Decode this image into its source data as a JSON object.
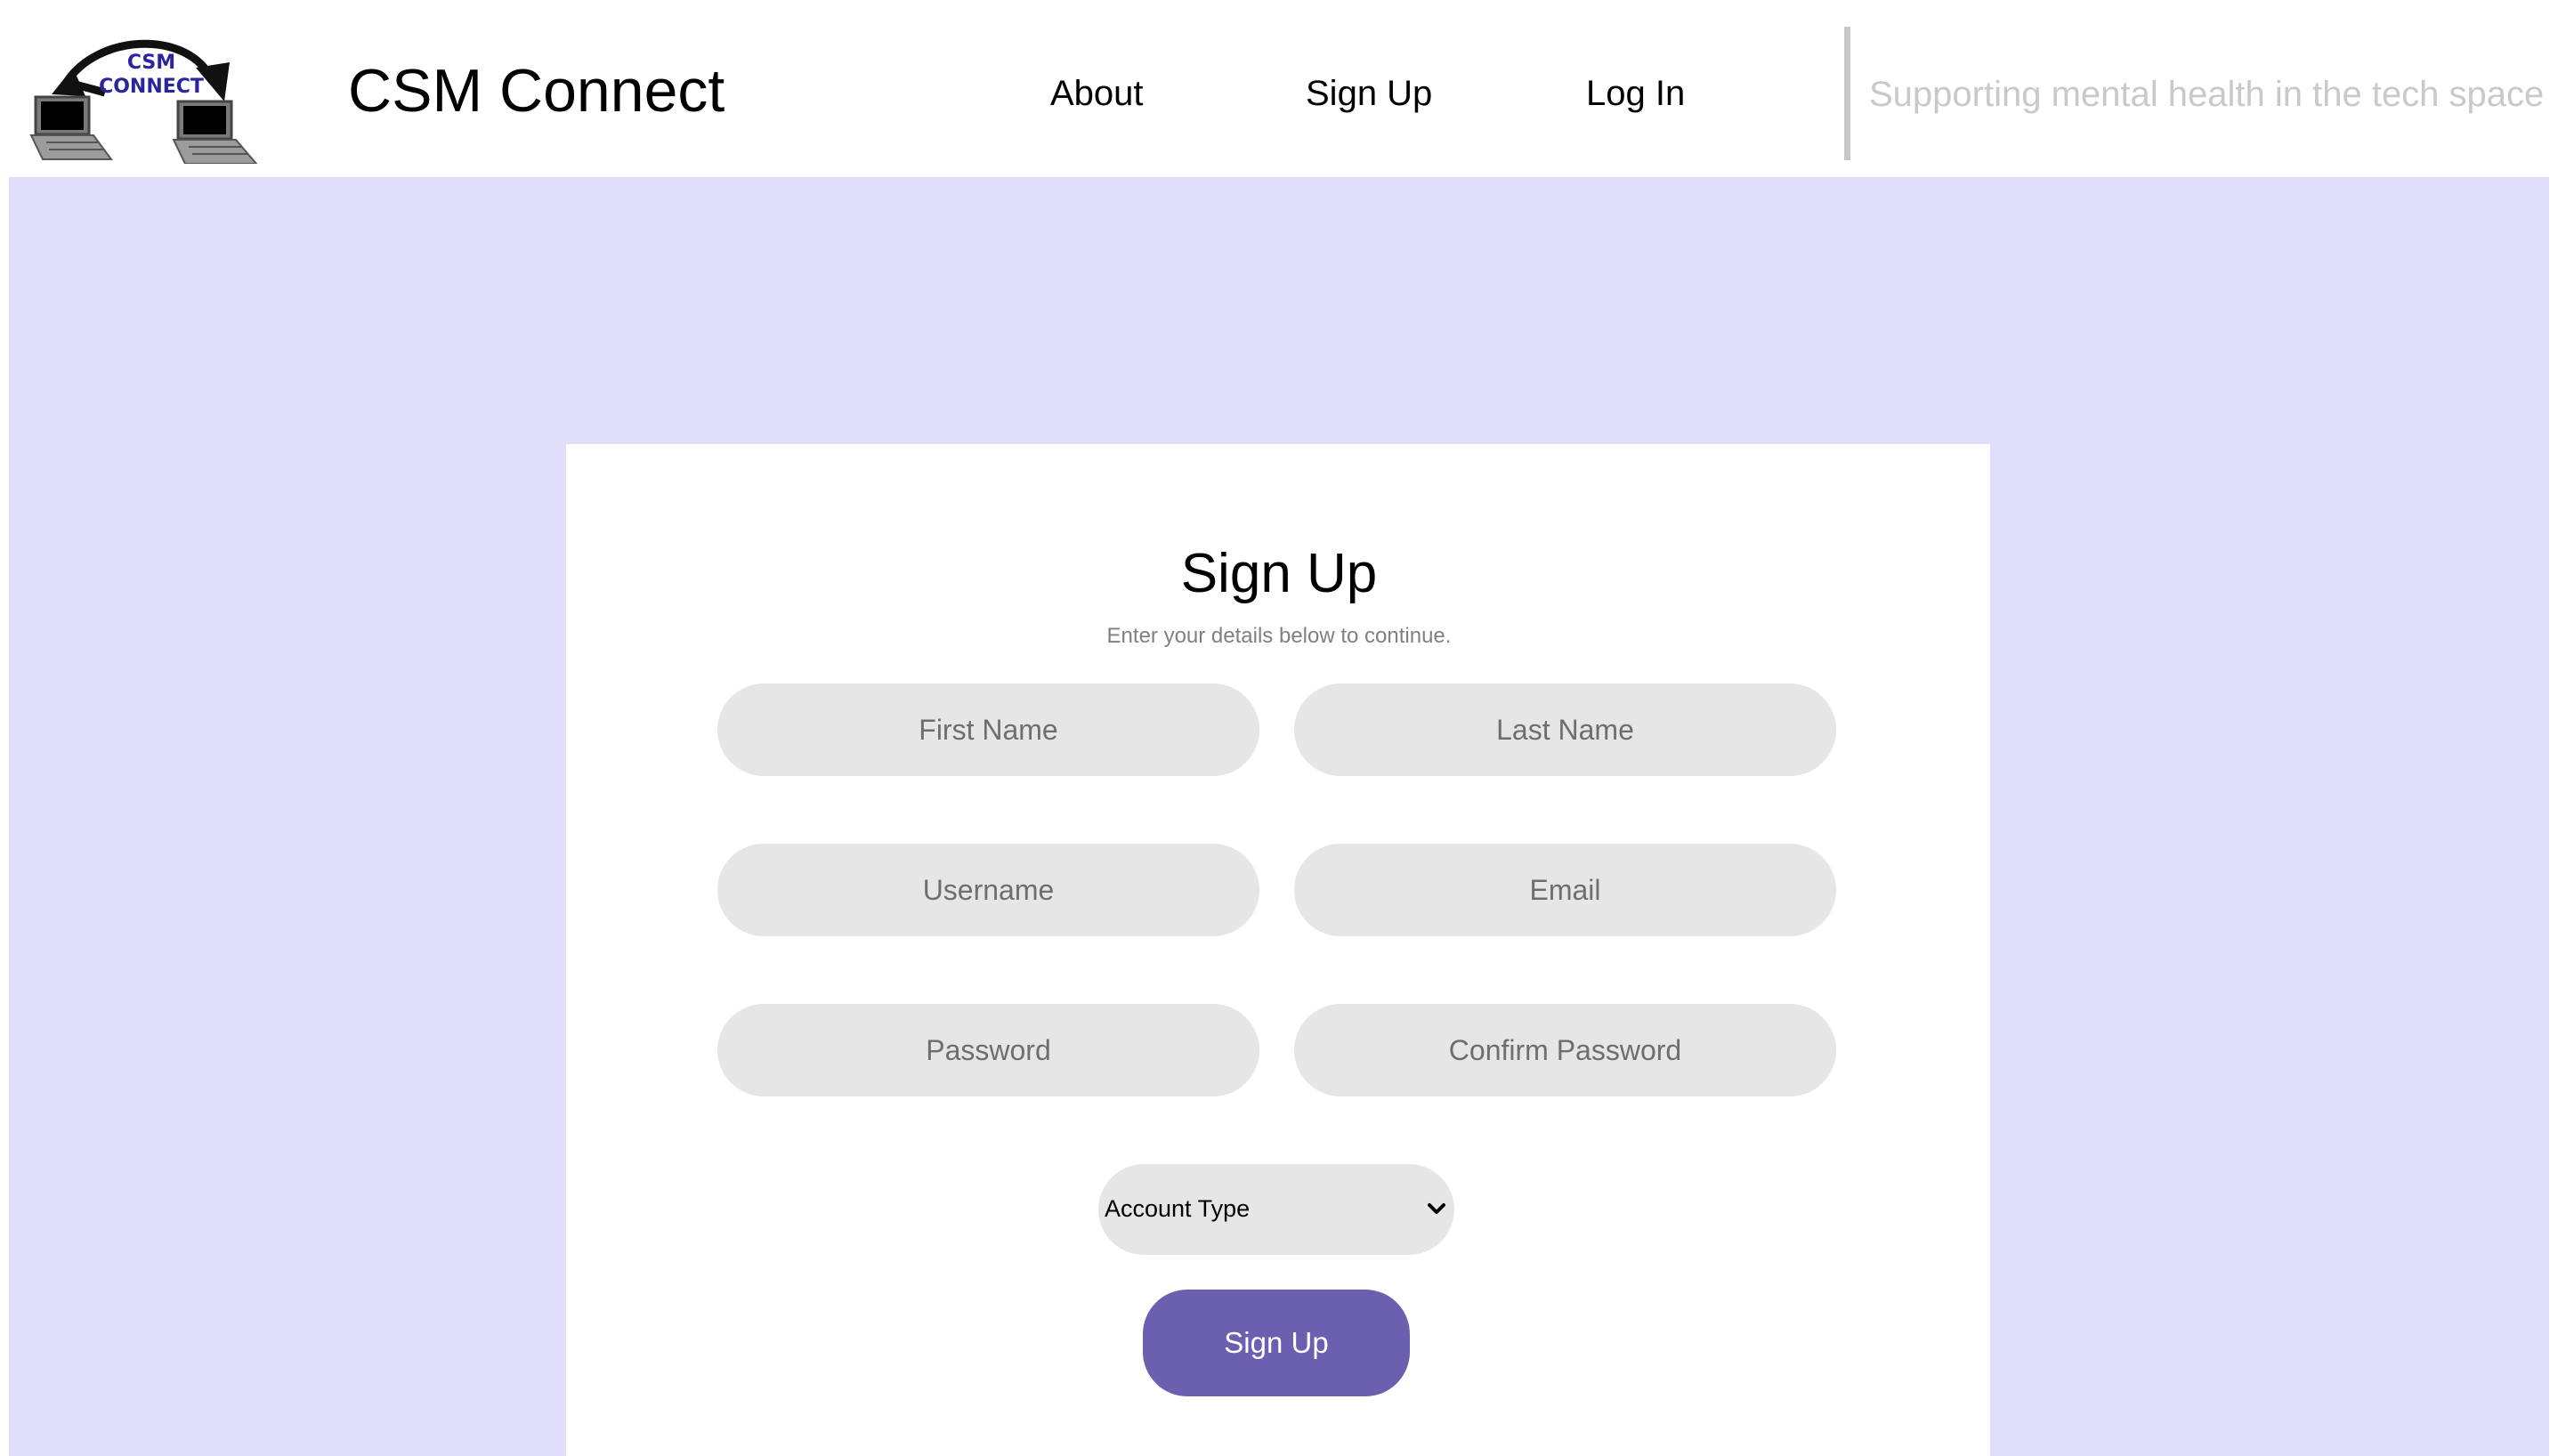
{
  "header": {
    "logo": {
      "icon": "csm-connect-logo-icon",
      "text_line_1": "CSM",
      "text_line_2": "CONNECT"
    },
    "brand": "CSM Connect",
    "nav": {
      "about": "About",
      "sign_up": "Sign Up",
      "log_in": "Log In"
    },
    "tagline": "Supporting mental health in the tech space"
  },
  "form": {
    "title": "Sign Up",
    "subtitle": "Enter your details below to continue.",
    "fields": {
      "first_name": {
        "placeholder": "First Name",
        "value": ""
      },
      "last_name": {
        "placeholder": "Last Name",
        "value": ""
      },
      "username": {
        "placeholder": "Username",
        "value": ""
      },
      "email": {
        "placeholder": "Email",
        "value": ""
      },
      "password": {
        "placeholder": "Password",
        "value": ""
      },
      "confirm_password": {
        "placeholder": "Confirm Password",
        "value": ""
      }
    },
    "account_type": {
      "selected": "Account Type",
      "icon": "chevron-down-icon"
    },
    "submit_label": "Sign Up"
  },
  "colors": {
    "page_background": "#e0defb",
    "card_background": "#ffffff",
    "field_background": "#e6e6e6",
    "button_primary": "#6b5fb0",
    "tagline_text": "#c9c9c9",
    "logo_text": "#2a24a0"
  }
}
